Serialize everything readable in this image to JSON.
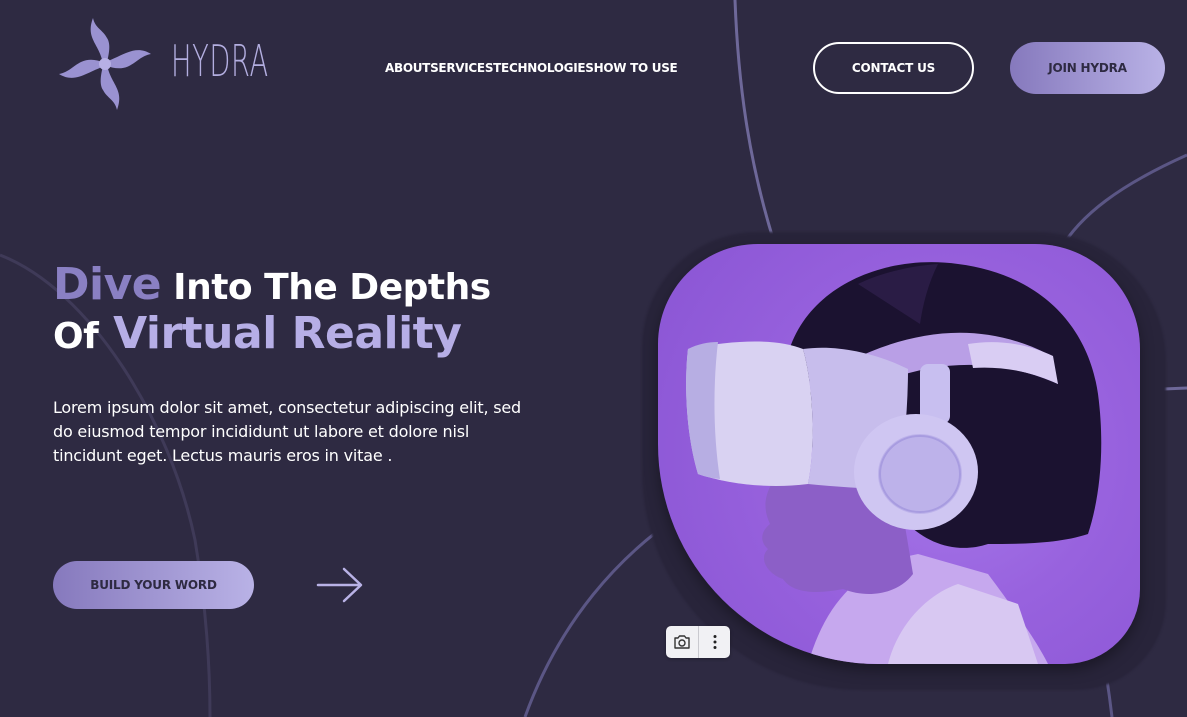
{
  "brand": {
    "name": "HYDRA",
    "logo_icon": "hydra-swirl-logo"
  },
  "nav": {
    "items": [
      {
        "label": "ABOUT"
      },
      {
        "label": "SERVICES"
      },
      {
        "label": "TECHNOLOGIES"
      },
      {
        "label": "HOW TO USE"
      }
    ]
  },
  "header": {
    "contact_label": "CONTACT US",
    "join_label": "JOIN HYDRA"
  },
  "hero": {
    "title_word1": "Dive",
    "title_rest1": " Into The Depths",
    "title_word2": "Of",
    "title_rest2": " Virtual Reality",
    "description": "Lorem ipsum dolor sit amet, consectetur adipiscing elit, sed do eiusmod tempor incididunt ut labore et dolore nisl tincidunt eget. Lectus mauris eros in vitae .",
    "cta_label": "BUILD YOUR WORD",
    "arrow_icon": "arrow-right-icon"
  },
  "image": {
    "subject_icon": "vr-headset-person"
  },
  "tool": {
    "camera_icon": "camera-icon",
    "more_icon": "more-vertical-icon"
  },
  "colors": {
    "background": "#2e2a42",
    "accent_dark": "#8679bd",
    "accent_light": "#b9b2e6",
    "image_purple": "#9862de"
  }
}
